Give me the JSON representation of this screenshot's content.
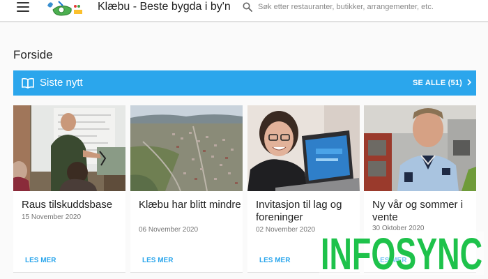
{
  "header": {
    "title": "Klæbu - Beste bygda i by'n",
    "search_placeholder": "Søk etter restauranter, butikker, arrangementer, etc."
  },
  "page": {
    "title": "Forside"
  },
  "news": {
    "heading": "Siste nytt",
    "see_all": "SE ALLE (51)",
    "accent": "#2ba6ec"
  },
  "cards": [
    {
      "title": "Raus tilskuddsbase",
      "date": "15 November 2020",
      "read_more": "LES MER"
    },
    {
      "title": "Klæbu har blitt mindre",
      "date": "06 November 2020",
      "read_more": "LES MER"
    },
    {
      "title": "Invitasjon til lag og foreninger",
      "date": "02 November 2020",
      "read_more": "LES MER"
    },
    {
      "title": "Ny vår og sommer i vente",
      "date": "30 Oktober 2020",
      "read_more": "LES MER"
    }
  ],
  "watermark": {
    "text": "INFOSYNC",
    "color": "#1ec24b"
  }
}
